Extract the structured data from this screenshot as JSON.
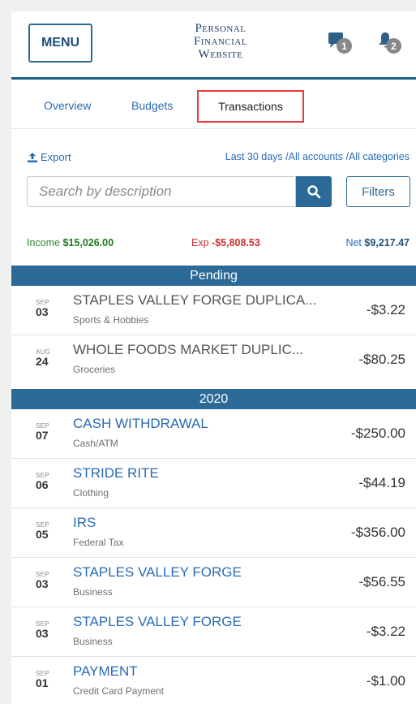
{
  "header": {
    "menu_label": "MENU",
    "site_title_line1": "Personal",
    "site_title_line2": "Financial",
    "site_title_line3": "Website",
    "icon_a_badge": "1",
    "icon_b_badge": "2"
  },
  "tabs": {
    "overview": "Overview",
    "budgets": "Budgets",
    "transactions": "Transactions"
  },
  "toolbar": {
    "export_label": "Export",
    "range_label": "Last 30 days /All accounts /All categories",
    "search_placeholder": "Search by description",
    "filters_label": "Filters"
  },
  "summary": {
    "income_label": "Income",
    "income_value": "$15,026.00",
    "exp_label": "Exp",
    "exp_value": "-$5,808.53",
    "net_label": "Net",
    "net_value": "$9,217.47"
  },
  "sections": {
    "pending": "Pending",
    "year": "2020"
  },
  "pending": [
    {
      "mon": "SEP",
      "day": "03",
      "desc": "STAPLES VALLEY FORGE DUPLICA...",
      "cat": "Sports & Hobbies",
      "amt": "-$3.22"
    },
    {
      "mon": "AUG",
      "day": "24",
      "desc": "WHOLE FOODS MARKET DUPLIC...",
      "cat": "Groceries",
      "amt": "-$80.25"
    }
  ],
  "transactions": [
    {
      "mon": "SEP",
      "day": "07",
      "desc": "CASH WITHDRAWAL",
      "cat": "Cash/ATM",
      "amt": "-$250.00"
    },
    {
      "mon": "SEP",
      "day": "06",
      "desc": "STRIDE RITE",
      "cat": "Clothing",
      "amt": "-$44.19"
    },
    {
      "mon": "SEP",
      "day": "05",
      "desc": "IRS",
      "cat": "Federal Tax",
      "amt": "-$356.00"
    },
    {
      "mon": "SEP",
      "day": "03",
      "desc": "STAPLES VALLEY FORGE",
      "cat": "Business",
      "amt": "-$56.55"
    },
    {
      "mon": "SEP",
      "day": "03",
      "desc": "STAPLES VALLEY FORGE",
      "cat": "Business",
      "amt": "-$3.22"
    },
    {
      "mon": "SEP",
      "day": "01",
      "desc": "PAYMENT",
      "cat": "Credit Card Payment",
      "amt": "-$1.00"
    }
  ],
  "colors": {
    "accent": "#2b6a96",
    "income": "#2e8a2e",
    "expense": "#d23030",
    "highlight": "#e53a3a"
  }
}
